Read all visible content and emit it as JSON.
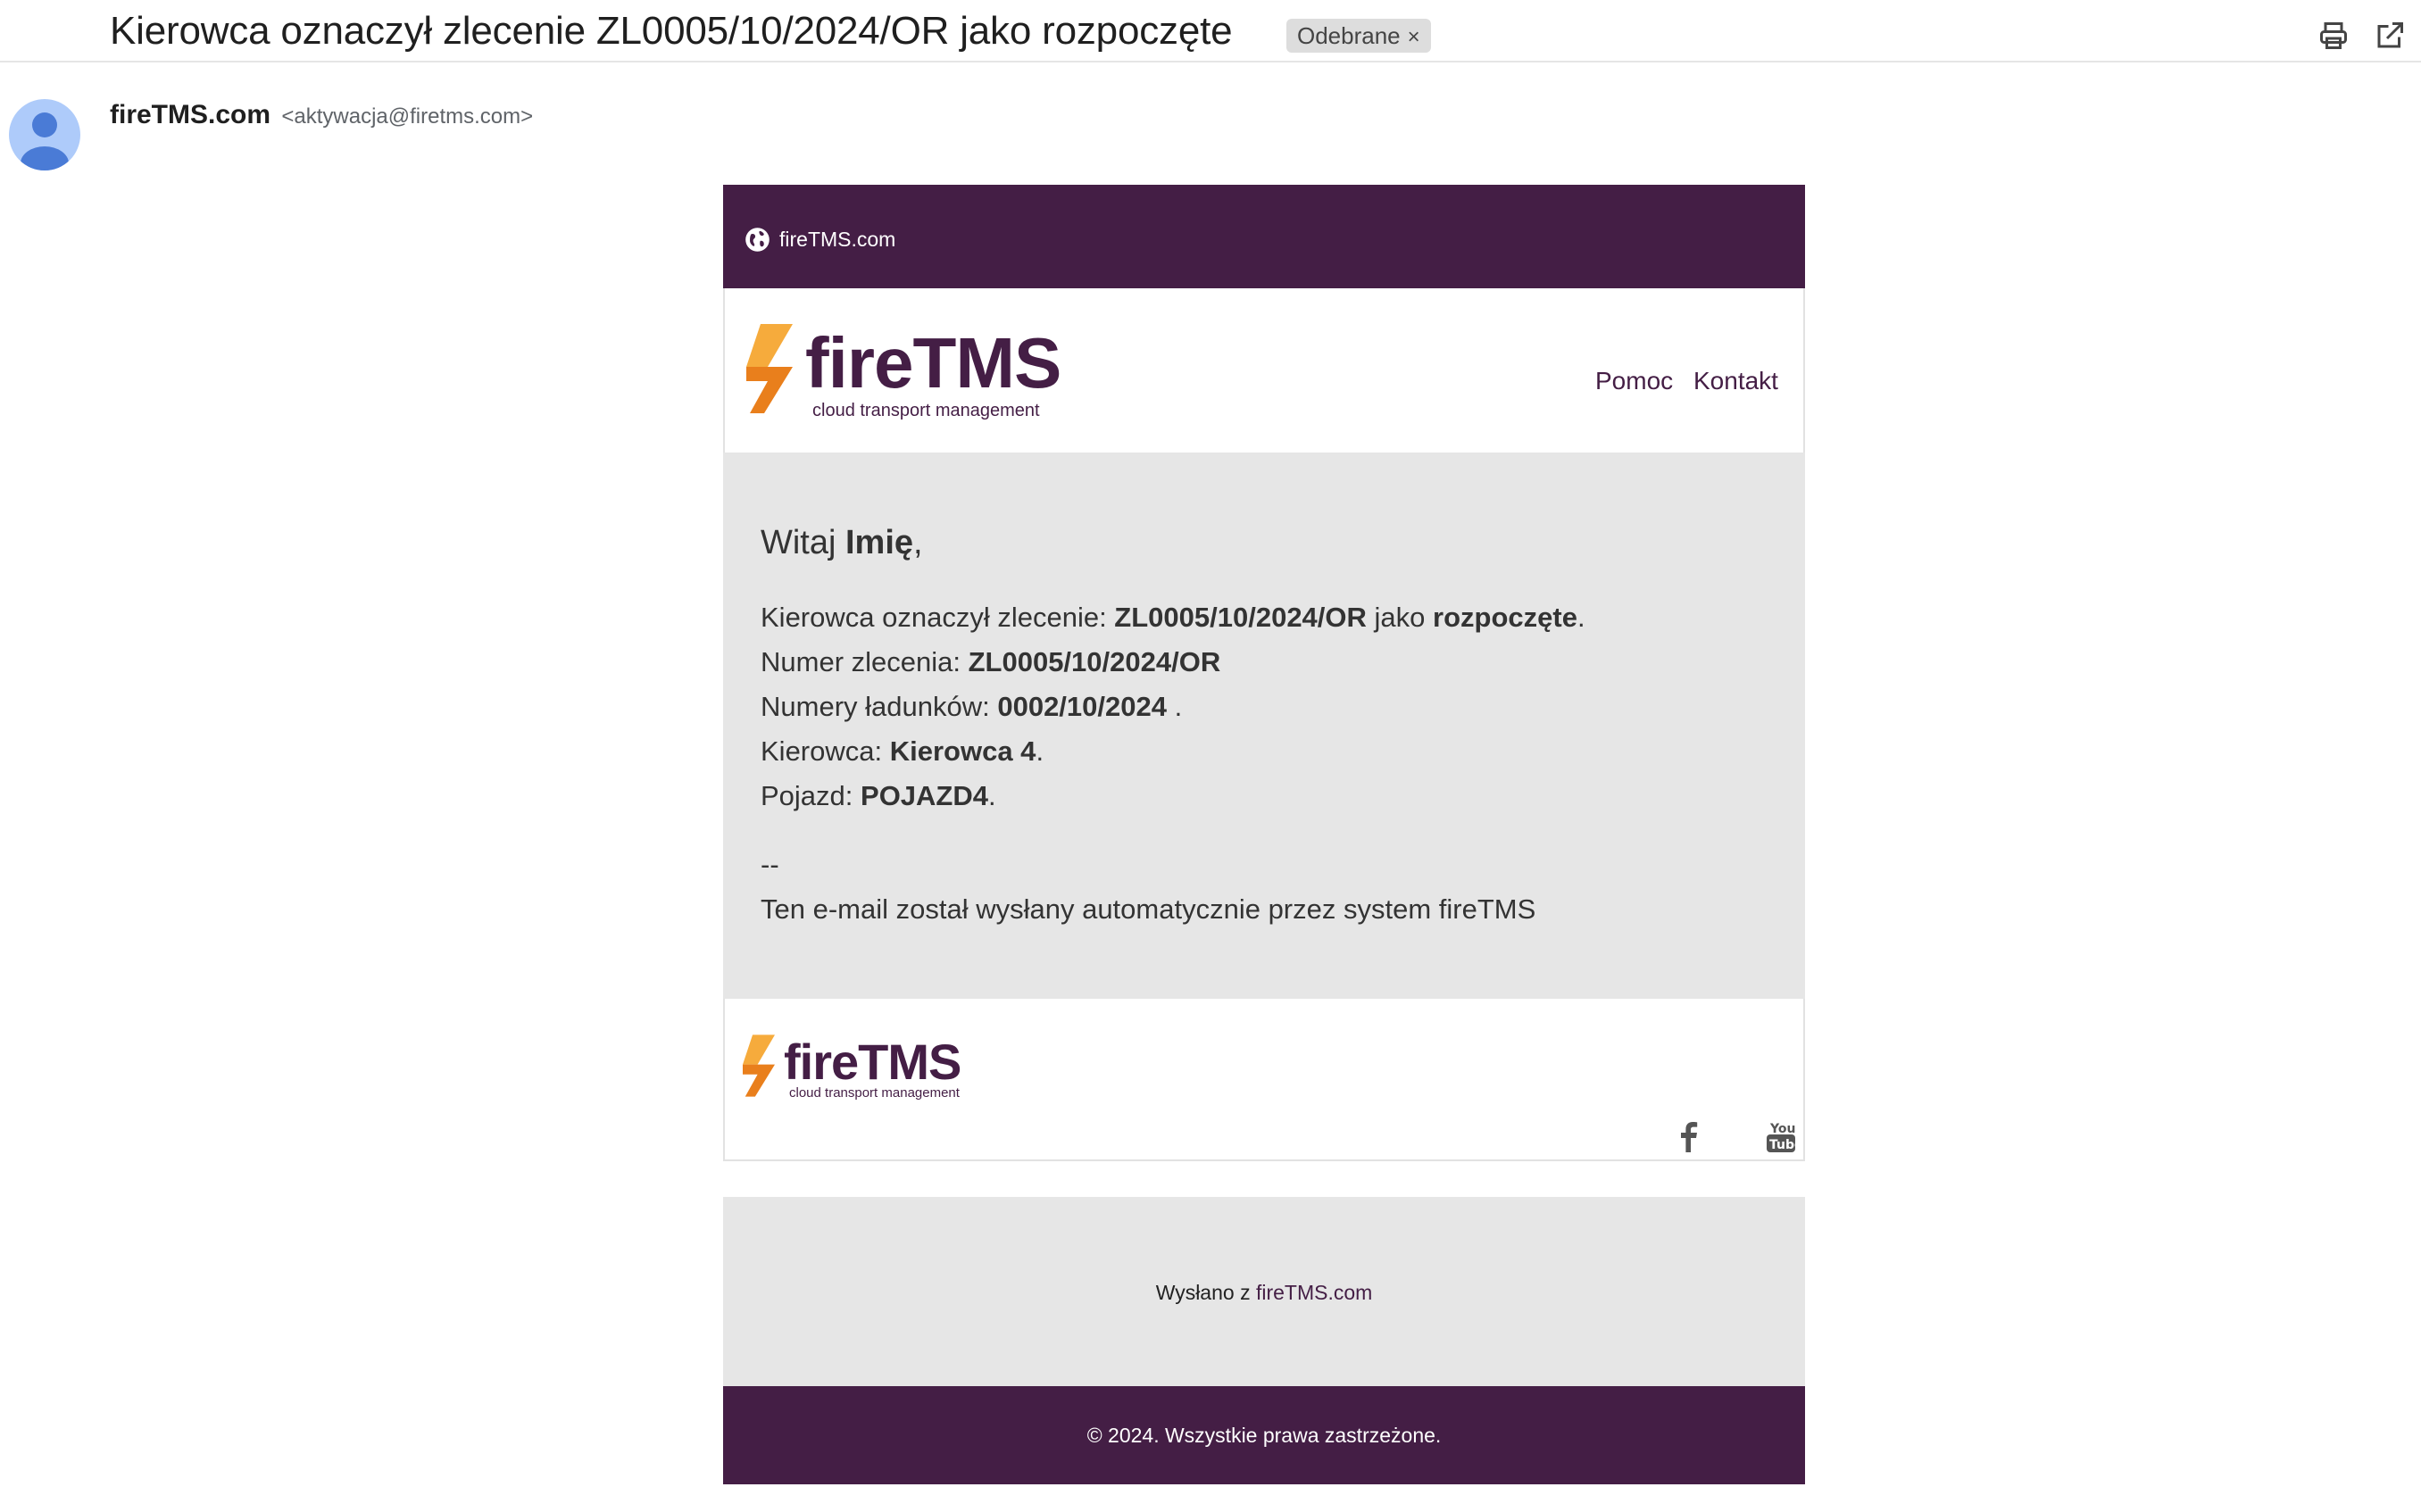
{
  "header": {
    "subject": "Kierowca oznaczył zlecenie ZL0005/10/2024/OR jako rozpoczęte",
    "label": "Odebrane",
    "label_remove": "×",
    "icons": [
      "print-icon",
      "open-in-new-window-icon"
    ]
  },
  "sender": {
    "name": "fireTMS.com",
    "email": "<aktywacja@firetms.com>"
  },
  "email": {
    "top_band": {
      "site": "fireTMS.com",
      "icon": "globe-icon"
    },
    "logo": {
      "word": "fireTMS",
      "tagline": "cloud transport management"
    },
    "nav": {
      "help": "Pomoc",
      "contact": "Kontakt"
    },
    "greeting": {
      "prefix": "Witaj ",
      "name": "Imię",
      "suffix": ","
    },
    "lines": {
      "l1": {
        "prefix": "Kierowca oznaczył zlecenie: ",
        "order": "ZL0005/10/2024/OR",
        "mid": " jako ",
        "status": "rozpoczęte",
        "end": "."
      },
      "l2": {
        "prefix": "Numer zlecenia: ",
        "value": "ZL0005/10/2024/OR"
      },
      "l3": {
        "prefix": "Numery ładunków: ",
        "value": "0002/10/2024",
        "end": " ."
      },
      "l4": {
        "prefix": "Kierowca: ",
        "value": "Kierowca 4",
        "end": "."
      },
      "l5": {
        "prefix": "Pojazd: ",
        "value": "POJAZD4",
        "end": "."
      }
    },
    "signature_sep": "--",
    "signature": "Ten e-mail został wysłany automatycznie przez system fireTMS",
    "footer_logo": {
      "word": "fireTMS",
      "tagline": "cloud transport management"
    },
    "social": [
      "facebook-icon",
      "youtube-icon"
    ],
    "sent_from": {
      "prefix": "Wysłano z ",
      "link": "fireTMS.com"
    },
    "copyright": "© 2024. Wszystkie prawa zastrzeżone."
  },
  "colors": {
    "brand_purple": "#441e45",
    "brand_orange_light": "#f6ab3c",
    "brand_orange_dark": "#e97f1c",
    "content_bg": "#e6e6e6"
  }
}
